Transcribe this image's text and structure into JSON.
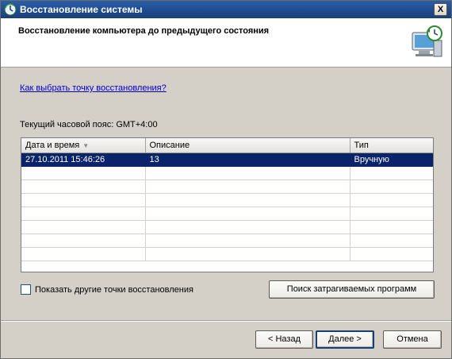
{
  "window": {
    "title": "Восстановление системы",
    "close_label": "X"
  },
  "header": {
    "heading": "Восстановление компьютера до предыдущего состояния"
  },
  "help_link": "Как выбрать точку восстановления?",
  "timezone": "Текущий часовой пояс: GMT+4:00",
  "table": {
    "columns": [
      "Дата и время",
      "Описание",
      "Тип"
    ],
    "sort_indicator": "▼",
    "rows": [
      {
        "date": "27.10.2011 15:46:26",
        "description": "13",
        "type": "Вручную",
        "selected": true
      }
    ]
  },
  "show_more": {
    "label": "Показать другие точки восстановления",
    "checked": false
  },
  "buttons": {
    "scan": "Поиск затрагиваемых программ",
    "back": "< Назад",
    "next": "Далее >",
    "cancel": "Отмена"
  },
  "colors": {
    "selection": "#0a246a",
    "titlebar": "#1f4c8f",
    "link": "#0000cc"
  }
}
